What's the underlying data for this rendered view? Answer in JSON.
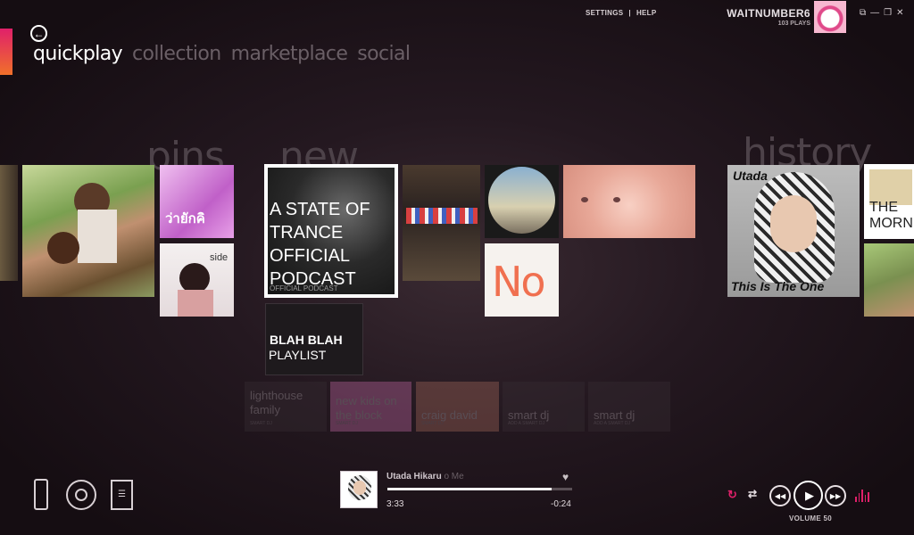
{
  "window": {
    "settings_label": "SETTINGS",
    "separator": "|",
    "help_label": "HELP",
    "username": "WAITNUMBER6",
    "plays": "103 PLAYS"
  },
  "pivot": {
    "items": [
      "quickplay",
      "collection",
      "marketplace",
      "social"
    ],
    "active": "quickplay"
  },
  "sections": {
    "pins": "pins",
    "new": "new",
    "history": "history"
  },
  "tiles": {
    "trance_title": "A STATE OF TRANCE OFFICIAL PODCAST",
    "trance_sub": "OFFICIAL PODCAST",
    "blah_title": "BLAH BLAH",
    "blah_sub": "PLAYLIST",
    "no_text": "No",
    "pin_thai_text": "ว่ายักคิ",
    "pin_side_text": "side",
    "utada_artist": "Utada",
    "utada_album": "This Is The One",
    "history_morn_text": "THE MORN"
  },
  "smart_row": [
    {
      "label": "lighthouse family",
      "sub": "SMART DJ"
    },
    {
      "label": "new kids on the block",
      "sub": "SMART DJ"
    },
    {
      "label": "craig david",
      "sub": "SMART DJ"
    },
    {
      "label": "smart dj",
      "sub": "ADD A SMART DJ"
    },
    {
      "label": "smart dj",
      "sub": "ADD A SMART DJ"
    }
  ],
  "now_playing": {
    "artist": "Utada Hikaru",
    "track_fragment": "o Me",
    "elapsed": "3:33",
    "remaining": "-0:24",
    "progress_fraction": 0.89,
    "volume_label": "VOLUME 50"
  },
  "colors": {
    "accent_pink": "#e0206a",
    "accent_orange": "#f0702a"
  },
  "icons": [
    "back-arrow-icon",
    "phone-icon",
    "disc-icon",
    "playlist-icon",
    "heart-icon",
    "repeat-icon",
    "shuffle-icon",
    "previous-icon",
    "play-icon",
    "next-icon",
    "equalizer-icon"
  ]
}
